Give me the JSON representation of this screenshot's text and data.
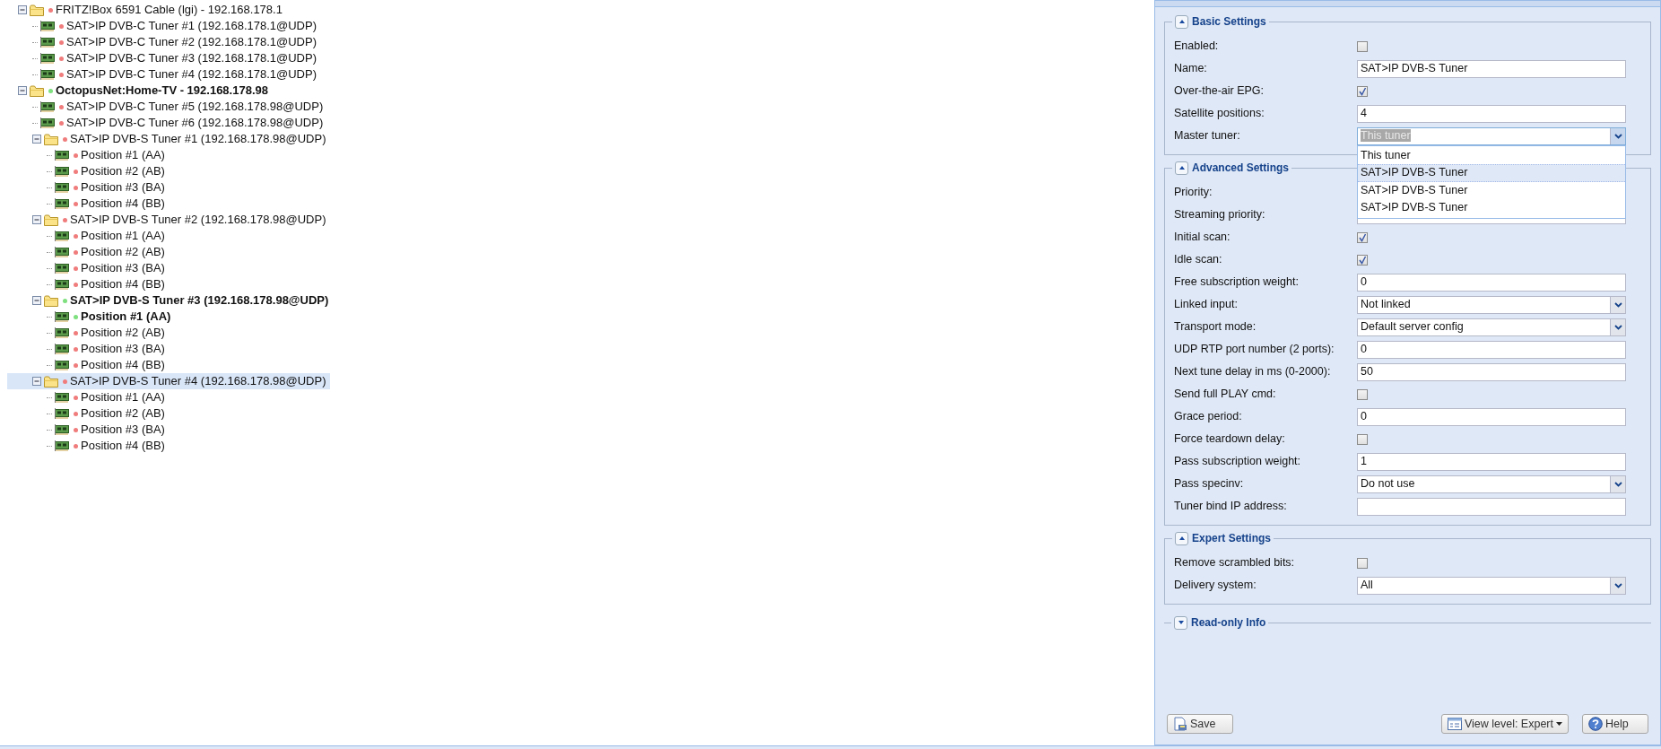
{
  "tree": [
    {
      "label": "FRITZ!Box 6591 Cable (lgi) - 192.168.178.1",
      "kind": "folder",
      "expanded": true,
      "active": false,
      "selected": false,
      "color": "#f07c7c",
      "children": [
        {
          "label": "SAT>IP DVB-C Tuner #1 (192.168.178.1@UDP)",
          "kind": "tuner",
          "active": false,
          "selected": false,
          "color": "#f07c7c"
        },
        {
          "label": "SAT>IP DVB-C Tuner #2 (192.168.178.1@UDP)",
          "kind": "tuner",
          "active": false,
          "selected": false,
          "color": "#f07c7c"
        },
        {
          "label": "SAT>IP DVB-C Tuner #3 (192.168.178.1@UDP)",
          "kind": "tuner",
          "active": false,
          "selected": false,
          "color": "#f07c7c"
        },
        {
          "label": "SAT>IP DVB-C Tuner #4 (192.168.178.1@UDP)",
          "kind": "tuner",
          "active": false,
          "selected": false,
          "color": "#f07c7c"
        }
      ]
    },
    {
      "label": "OctopusNet:Home-TV - 192.168.178.98",
      "kind": "folder",
      "expanded": true,
      "active": true,
      "selected": false,
      "color": "#7ee07e",
      "children": [
        {
          "label": "SAT>IP DVB-C Tuner #5 (192.168.178.98@UDP)",
          "kind": "tuner",
          "active": false,
          "selected": false,
          "color": "#f07c7c"
        },
        {
          "label": "SAT>IP DVB-C Tuner #6 (192.168.178.98@UDP)",
          "kind": "tuner",
          "active": false,
          "selected": false,
          "color": "#f07c7c"
        },
        {
          "label": "SAT>IP DVB-S Tuner #1 (192.168.178.98@UDP)",
          "kind": "folder",
          "expanded": true,
          "active": false,
          "selected": false,
          "color": "#f07c7c",
          "children": [
            {
              "label": "Position #1 (AA)",
              "kind": "tuner",
              "active": false,
              "selected": false,
              "color": "#f07c7c"
            },
            {
              "label": "Position #2 (AB)",
              "kind": "tuner",
              "active": false,
              "selected": false,
              "color": "#f07c7c"
            },
            {
              "label": "Position #3 (BA)",
              "kind": "tuner",
              "active": false,
              "selected": false,
              "color": "#f07c7c"
            },
            {
              "label": "Position #4 (BB)",
              "kind": "tuner",
              "active": false,
              "selected": false,
              "color": "#f07c7c"
            }
          ]
        },
        {
          "label": "SAT>IP DVB-S Tuner #2 (192.168.178.98@UDP)",
          "kind": "folder",
          "expanded": true,
          "active": false,
          "selected": false,
          "color": "#f07c7c",
          "children": [
            {
              "label": "Position #1 (AA)",
              "kind": "tuner",
              "active": false,
              "selected": false,
              "color": "#f07c7c"
            },
            {
              "label": "Position #2 (AB)",
              "kind": "tuner",
              "active": false,
              "selected": false,
              "color": "#f07c7c"
            },
            {
              "label": "Position #3 (BA)",
              "kind": "tuner",
              "active": false,
              "selected": false,
              "color": "#f07c7c"
            },
            {
              "label": "Position #4 (BB)",
              "kind": "tuner",
              "active": false,
              "selected": false,
              "color": "#f07c7c"
            }
          ]
        },
        {
          "label": "SAT>IP DVB-S Tuner #3 (192.168.178.98@UDP)",
          "kind": "folder",
          "expanded": true,
          "active": true,
          "selected": false,
          "color": "#7ee07e",
          "children": [
            {
              "label": "Position #1 (AA)",
              "kind": "tuner",
              "active": true,
              "selected": false,
              "color": "#7ee07e"
            },
            {
              "label": "Position #2 (AB)",
              "kind": "tuner",
              "active": false,
              "selected": false,
              "color": "#f07c7c"
            },
            {
              "label": "Position #3 (BA)",
              "kind": "tuner",
              "active": false,
              "selected": false,
              "color": "#f07c7c"
            },
            {
              "label": "Position #4 (BB)",
              "kind": "tuner",
              "active": false,
              "selected": false,
              "color": "#f07c7c"
            }
          ]
        },
        {
          "label": "SAT>IP DVB-S Tuner #4 (192.168.178.98@UDP)",
          "kind": "folder",
          "expanded": true,
          "active": false,
          "selected": true,
          "color": "#f07c7c",
          "children": [
            {
              "label": "Position #1 (AA)",
              "kind": "tuner",
              "active": false,
              "selected": false,
              "color": "#f07c7c"
            },
            {
              "label": "Position #2 (AB)",
              "kind": "tuner",
              "active": false,
              "selected": false,
              "color": "#f07c7c"
            },
            {
              "label": "Position #3 (BA)",
              "kind": "tuner",
              "active": false,
              "selected": false,
              "color": "#f07c7c"
            },
            {
              "label": "Position #4 (BB)",
              "kind": "tuner",
              "active": false,
              "selected": false,
              "color": "#f07c7c"
            }
          ]
        }
      ]
    }
  ],
  "settings": [
    {
      "title": "Basic Settings",
      "expanded": true,
      "fields": [
        {
          "label": "Enabled:",
          "kind": "checkbox",
          "checked": false
        },
        {
          "label": "Name:",
          "kind": "text",
          "value": "SAT>IP DVB-S Tuner"
        },
        {
          "label": "Over-the-air EPG:",
          "kind": "checkbox",
          "checked": true
        },
        {
          "label": "Satellite positions:",
          "kind": "text",
          "value": "4"
        },
        {
          "label": "Master tuner:",
          "kind": "combo",
          "value": "This tuner",
          "options": [
            {
              "label": "This tuner",
              "highlighted": false
            },
            {
              "label": "SAT>IP DVB-S Tuner",
              "highlighted": true
            },
            {
              "label": "SAT>IP DVB-S Tuner",
              "highlighted": false
            },
            {
              "label": "SAT>IP DVB-S Tuner",
              "highlighted": false
            }
          ]
        }
      ]
    },
    {
      "title": "Advanced Settings",
      "expanded": true,
      "fields": [
        {
          "label": "Priority:",
          "kind": "text"
        },
        {
          "label": "Streaming priority:",
          "kind": "text"
        },
        {
          "label": "Initial scan:",
          "kind": "checkbox",
          "checked": true
        },
        {
          "label": "Idle scan:",
          "kind": "checkbox",
          "checked": true
        },
        {
          "label": "Free subscription weight:",
          "kind": "text",
          "value": "0"
        },
        {
          "label": "Linked input:",
          "kind": "combo",
          "value": "Not linked"
        },
        {
          "label": "Transport mode:",
          "kind": "combo",
          "value": "Default server config"
        },
        {
          "label": "UDP RTP port number (2 ports):",
          "kind": "text",
          "value": "0"
        },
        {
          "label": "Next tune delay in ms (0-2000):",
          "kind": "text",
          "value": "50"
        },
        {
          "label": "Send full PLAY cmd:",
          "kind": "checkbox",
          "checked": false
        },
        {
          "label": "Grace period:",
          "kind": "text",
          "value": "0"
        },
        {
          "label": "Force teardown delay:",
          "kind": "checkbox",
          "checked": false
        },
        {
          "label": "Pass subscription weight:",
          "kind": "text",
          "value": "1"
        },
        {
          "label": "Pass specinv:",
          "kind": "combo",
          "value": "Do not use"
        },
        {
          "label": "Tuner bind IP address:",
          "kind": "text"
        }
      ]
    },
    {
      "title": "Expert Settings",
      "expanded": true,
      "fields": [
        {
          "label": "Remove scrambled bits:",
          "kind": "checkbox",
          "checked": false
        },
        {
          "label": "Delivery system:",
          "kind": "combo",
          "value": "All"
        }
      ]
    },
    {
      "title": "Read-only Info",
      "expanded": false
    }
  ],
  "buttons": [
    {
      "label": "Save",
      "kind": "save"
    },
    {
      "label": "View level: Expert",
      "kind": "menu"
    },
    {
      "label": "Help",
      "kind": "help"
    }
  ]
}
